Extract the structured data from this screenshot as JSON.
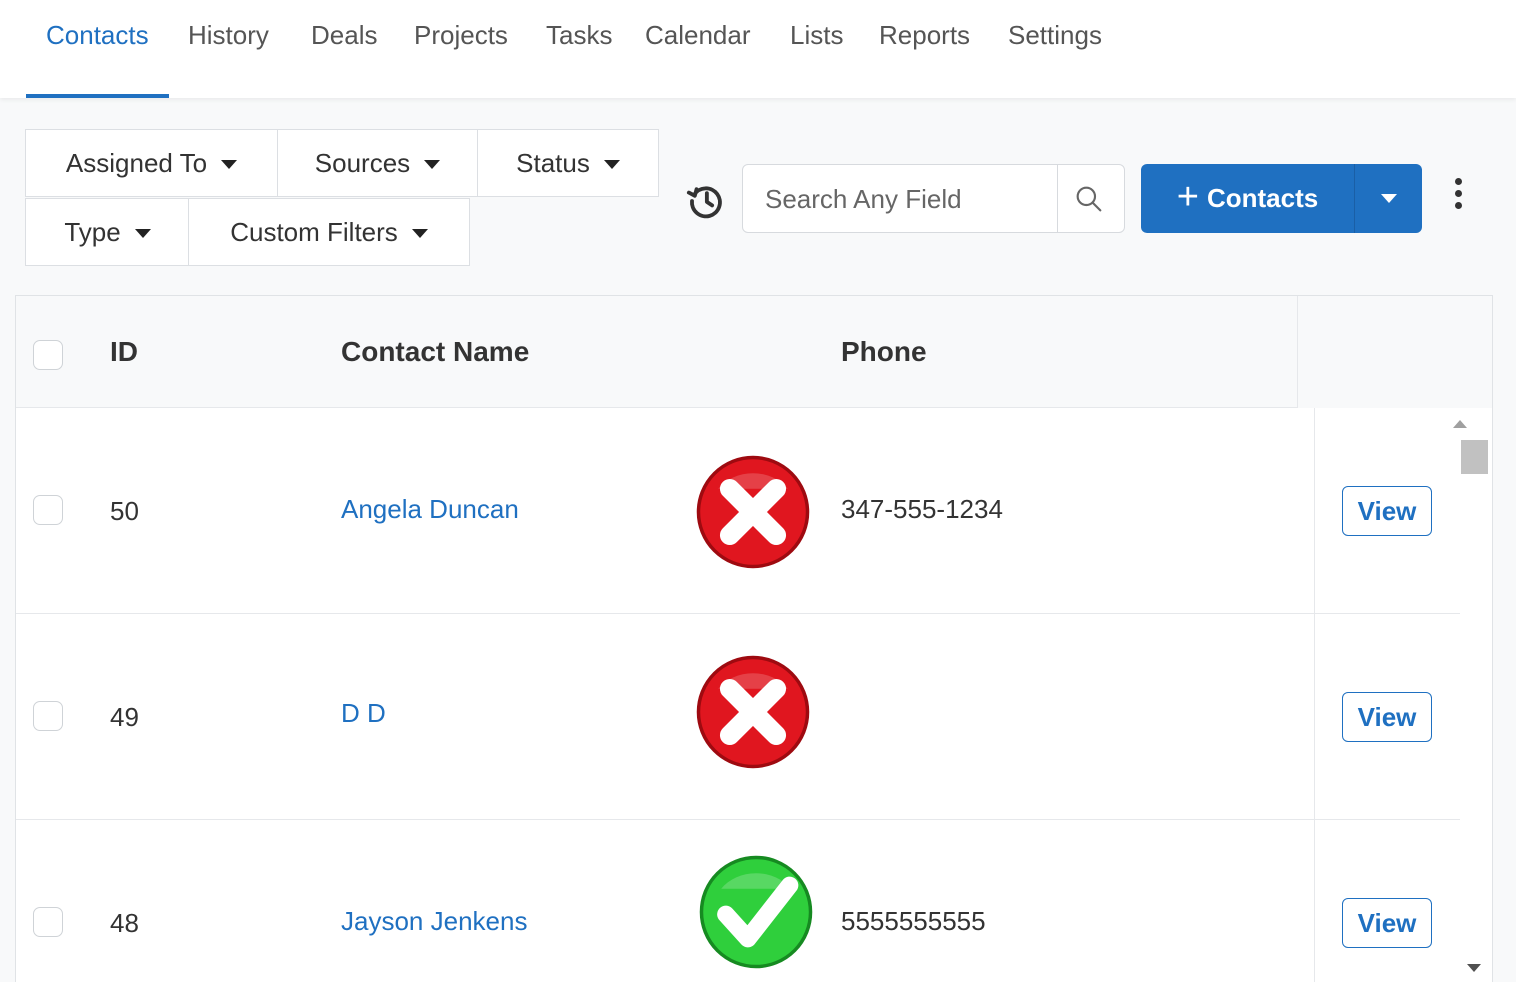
{
  "nav": {
    "tabs": [
      "Contacts",
      "History",
      "Deals",
      "Projects",
      "Tasks",
      "Calendar",
      "Lists",
      "Reports",
      "Settings"
    ],
    "active": "Contacts"
  },
  "filters": {
    "assigned_to": "Assigned To",
    "sources": "Sources",
    "status": "Status",
    "type": "Type",
    "custom_filters": "Custom Filters"
  },
  "search": {
    "placeholder": "Search Any Field",
    "value": ""
  },
  "actions": {
    "add_label": "Contacts"
  },
  "table": {
    "headers": {
      "id": "ID",
      "name": "Contact Name",
      "phone": "Phone"
    },
    "rows": [
      {
        "id": "50",
        "name": "Angela Duncan",
        "phone": "347-555-1234",
        "status": "invalid",
        "action": "View"
      },
      {
        "id": "49",
        "name": "D D",
        "phone": "",
        "status": "invalid",
        "action": "View"
      },
      {
        "id": "48",
        "name": "Jayson Jenkens",
        "phone": "5555555555",
        "status": "valid",
        "action": "View"
      }
    ]
  },
  "colors": {
    "accent": "#1f70c1",
    "invalid": "#e0161f",
    "valid": "#2fcf3c"
  },
  "icons": {
    "history": "history-icon",
    "search": "search-icon",
    "more": "kebab-icon",
    "invalid": "red-x-icon",
    "valid": "green-check-icon"
  }
}
